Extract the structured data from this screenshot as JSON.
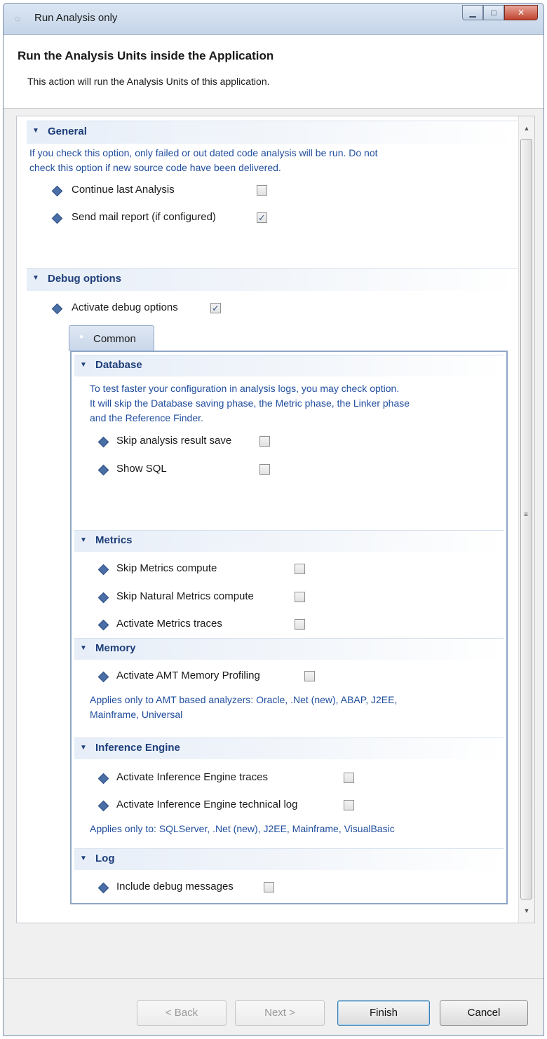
{
  "window": {
    "title": "Run Analysis only",
    "controls": {
      "minimize": "▁",
      "maximize": "□",
      "close": "✕"
    }
  },
  "header": {
    "title": "Run the Analysis Units inside the Application",
    "description": "This action will run the Analysis Units of this application."
  },
  "general": {
    "label": "General",
    "description_line1": "If you check this option, only failed or out dated code analysis will be run. Do not",
    "description_line2": "check this option if new source code have been delivered.",
    "options": [
      {
        "label": "Continue last Analysis",
        "checked": false
      },
      {
        "label": "Send mail report (if configured)",
        "checked": true
      }
    ]
  },
  "debug": {
    "label": "Debug options",
    "activate": {
      "label": "Activate debug options",
      "checked": true
    },
    "tab_label": "Common",
    "database": {
      "label": "Database",
      "description_line1": "To test faster your configuration in analysis logs, you may check option.",
      "description_line2": "It will skip the Database saving phase, the Metric phase, the Linker phase",
      "description_line3": "and the Reference Finder.",
      "options": [
        {
          "label": "Skip analysis result save",
          "checked": false
        },
        {
          "label": "Show SQL",
          "checked": false
        }
      ]
    },
    "metrics": {
      "label": "Metrics",
      "options": [
        {
          "label": "Skip Metrics compute",
          "checked": false
        },
        {
          "label": "Skip Natural Metrics compute",
          "checked": false
        },
        {
          "label": "Activate Metrics traces",
          "checked": false
        }
      ]
    },
    "memory": {
      "label": "Memory",
      "options": [
        {
          "label": "Activate AMT Memory Profiling",
          "checked": false
        }
      ],
      "note_line1": "Applies only to AMT based analyzers: Oracle, .Net (new), ABAP, J2EE,",
      "note_line2": "Mainframe, Universal"
    },
    "inference": {
      "label": "Inference Engine",
      "options": [
        {
          "label": "Activate Inference Engine traces",
          "checked": false
        },
        {
          "label": "Activate Inference Engine technical log",
          "checked": false
        }
      ],
      "note": "Applies only to: SQLServer, .Net (new), J2EE, Mainframe, VisualBasic"
    },
    "log": {
      "label": "Log",
      "options": [
        {
          "label": "Include debug messages",
          "checked": false
        }
      ]
    }
  },
  "checkmark": "✓",
  "scrollbar": {
    "up": "▲",
    "down": "▼",
    "grip": "≡"
  },
  "buttons": {
    "back": "< Back",
    "next": "Next >",
    "finish": "Finish",
    "cancel": "Cancel"
  },
  "colors": {
    "accent": "#1e3f7a",
    "description_text": "#1f4d9e"
  }
}
